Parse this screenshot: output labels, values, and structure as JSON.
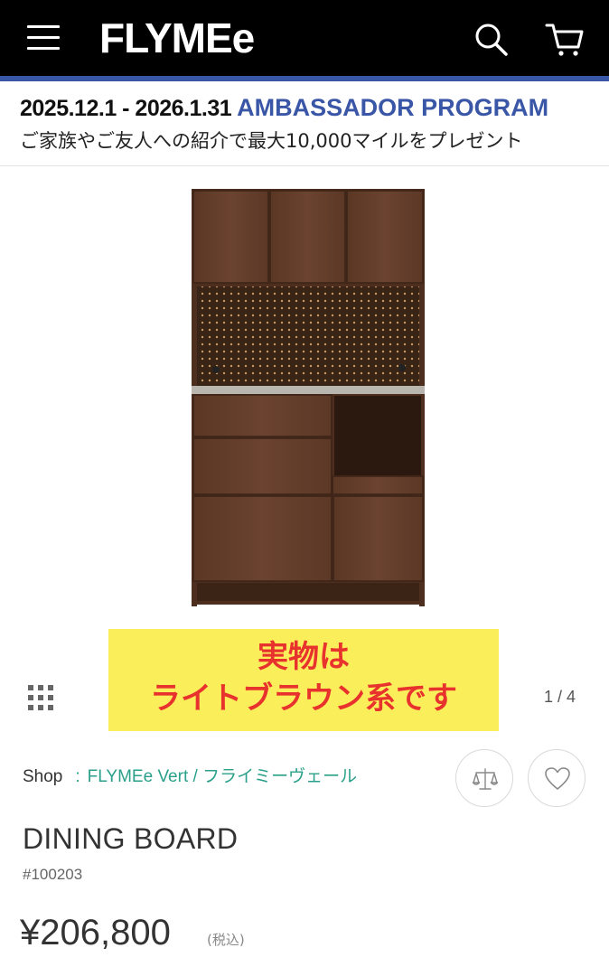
{
  "header": {
    "logo": "FLYMEe",
    "menu_icon": "hamburger-menu-icon",
    "search_icon": "search-icon",
    "cart_icon": "cart-icon",
    "background_color": "#000000",
    "accent_color": "#3a56a6"
  },
  "banner": {
    "dates": "2025.12.1 - 2026.1.31",
    "program": "AMBASSADOR PROGRAM",
    "subtitle": "ご家族やご友人への紹介で最大10,000マイルをプレゼント"
  },
  "gallery": {
    "overlay_line1": "実物は",
    "overlay_line2": "ライトブラウン系です",
    "overlay_bg_color": "#fbee5b",
    "overlay_text_color": "#e8322d",
    "pager": "1 / 4",
    "grid_icon": "grid-icon"
  },
  "shop": {
    "label": "Shop",
    "separator": ":",
    "brand": "FLYMEe Vert / フライミーヴェール",
    "link_color": "#2aa08a",
    "compare_icon": "scale-compare-icon",
    "favorite_icon": "heart-icon"
  },
  "product": {
    "title": "DINING BOARD",
    "sku": "#100203",
    "price": "¥206,800",
    "tax_note": "(税込)"
  }
}
